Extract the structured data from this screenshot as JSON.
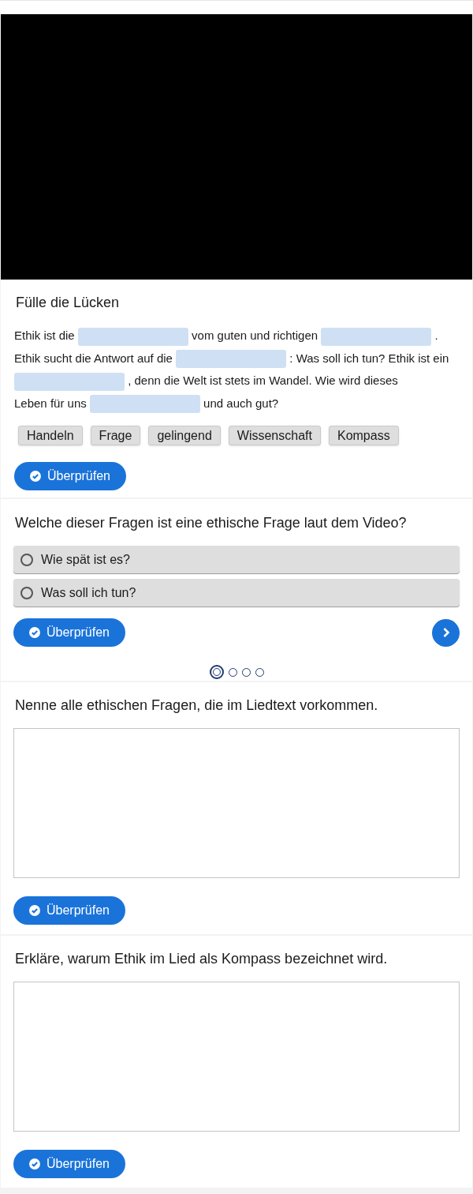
{
  "cloze": {
    "title": "Fülle die Lücken",
    "segments": [
      {
        "kind": "text",
        "text": "Ethik ist die"
      },
      {
        "kind": "gap"
      },
      {
        "kind": "text",
        "text": "vom guten und richtigen"
      },
      {
        "kind": "gap"
      },
      {
        "kind": "text",
        "text": "."
      },
      {
        "kind": "text",
        "text": "Ethik sucht die Antwort auf die"
      },
      {
        "kind": "gap"
      },
      {
        "kind": "text",
        "text": ": Was soll ich tun? Ethik ist"
      },
      {
        "kind": "text",
        "text": "ein"
      },
      {
        "kind": "gap"
      },
      {
        "kind": "text",
        "text": ", denn die Welt ist stets im Wandel. Wie wird dieses"
      },
      {
        "kind": "text",
        "text": "Leben für uns"
      },
      {
        "kind": "gap"
      },
      {
        "kind": "text",
        "text": "und auch gut?"
      }
    ],
    "words": [
      "Handeln",
      "Frage",
      "gelingend",
      "Wissenschaft",
      "Kompass"
    ],
    "button": "Überprüfen"
  },
  "quiz": {
    "question": "Welche dieser Fragen ist eine ethische Frage laut dem Video?",
    "options": [
      {
        "label": "Wie spät ist es?",
        "selected": false
      },
      {
        "label": "Was soll ich tun?",
        "selected": false
      }
    ],
    "button": "Überprüfen",
    "pages": [
      {
        "selected": true
      },
      {
        "selected": false
      },
      {
        "selected": false
      },
      {
        "selected": false
      }
    ]
  },
  "essays": [
    {
      "question": "Nenne alle ethischen Fragen, die im Liedtext vorkommen.",
      "button": "Überprüfen"
    },
    {
      "question": "Erkläre, warum Ethik im Lied als Kompass bezeichnet wird.",
      "button": "Überprüfen"
    }
  ]
}
